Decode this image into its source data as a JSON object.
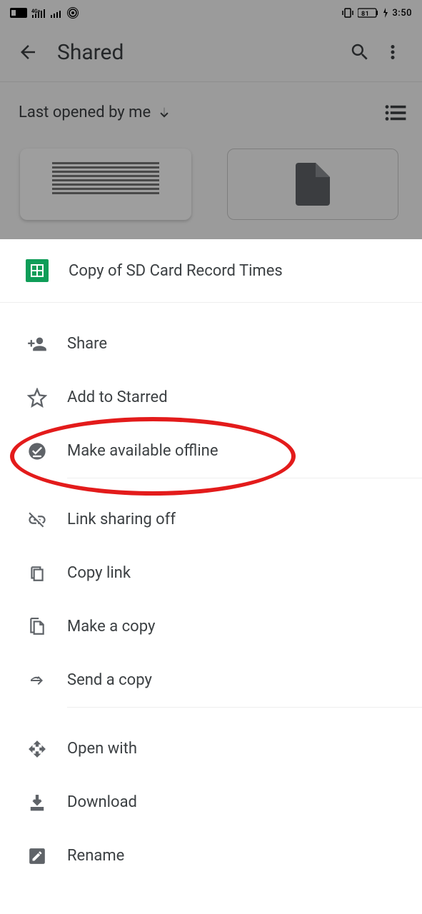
{
  "statusbar": {
    "battery": "81",
    "time": "3:50"
  },
  "appbar": {
    "title": "Shared"
  },
  "sort": {
    "label": "Last opened by me"
  },
  "sheet": {
    "file_title": "Copy of SD Card Record Times",
    "items": {
      "share": "Share",
      "star": "Add to Starred",
      "offline": "Make available offline",
      "linksharing": "Link sharing off",
      "copylink": "Copy link",
      "makecopy": "Make a copy",
      "sendcopy": "Send a copy",
      "openwith": "Open with",
      "download": "Download",
      "rename": "Rename"
    }
  }
}
